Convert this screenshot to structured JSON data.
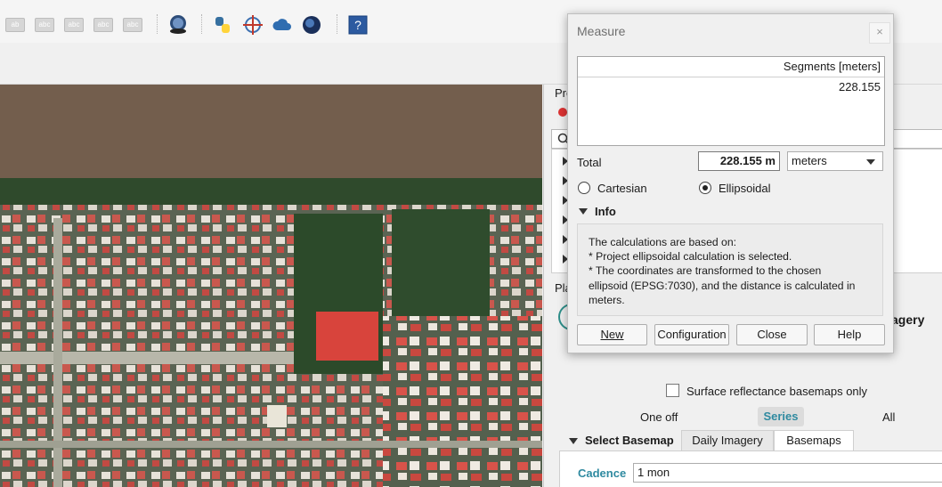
{
  "toolbar": {
    "icons": [
      "label-tool-icon",
      "show-hide-labels-icon",
      "move-label-icon",
      "rotate-label-icon",
      "change-label-icon",
      "planet-explorer-icon",
      "python-icon",
      "crosshair-plugin-icon",
      "cloud-icon",
      "globe-icon",
      "help-icon"
    ]
  },
  "map": {
    "description": ""
  },
  "right_panel": {
    "title_partial": "Pro",
    "section_partial": "Pla",
    "imagery_partial": "agery",
    "tabs": [
      "Daily Imagery",
      "Basemaps"
    ],
    "surface_reflectance_label": "Surface reflectance basemaps only",
    "mode_options": [
      "One off",
      "Series",
      "All"
    ],
    "selected_mode": "Series",
    "select_basemap_label": "Select Basemap",
    "cadence_label": "Cadence",
    "cadence_value": "1 mon"
  },
  "measure": {
    "title": "Measure",
    "close_symbol": "×",
    "segments_header": "Segments [meters]",
    "segments": [
      "228.155"
    ],
    "total_label": "Total",
    "total_value": "228.155 m",
    "unit": "meters",
    "cartesian_label": "Cartesian",
    "ellipsoidal_label": "Ellipsoidal",
    "selected_method": "Ellipsoidal",
    "info_label": "Info",
    "info_lines": [
      "The calculations are based on:",
      "* Project ellipsoidal calculation is selected.",
      "* The coordinates are transformed to the chosen",
      "ellipsoid (EPSG:7030), and the distance is calculated in",
      "meters."
    ],
    "buttons": {
      "new": "New",
      "configuration": "Configuration",
      "close": "Close",
      "help": "Help"
    }
  }
}
